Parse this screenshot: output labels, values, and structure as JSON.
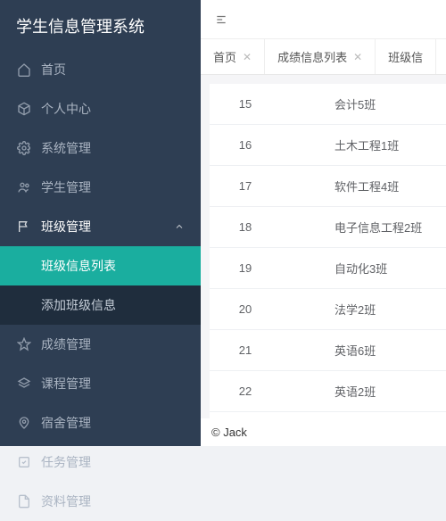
{
  "system_title": "学生信息管理系统",
  "sidebar": {
    "items": [
      {
        "label": "首页",
        "icon": "home"
      },
      {
        "label": "个人中心",
        "icon": "cube"
      },
      {
        "label": "系统管理",
        "icon": "gear"
      },
      {
        "label": "学生管理",
        "icon": "users"
      },
      {
        "label": "班级管理",
        "icon": "flag",
        "expanded": true
      },
      {
        "label": "成绩管理",
        "icon": "star"
      },
      {
        "label": "课程管理",
        "icon": "layers"
      },
      {
        "label": "宿舍管理",
        "icon": "location"
      },
      {
        "label": "任务管理",
        "icon": "check"
      },
      {
        "label": "资料管理",
        "icon": "doc"
      }
    ],
    "submenu": [
      {
        "label": "班级信息列表",
        "selected": true
      },
      {
        "label": "添加班级信息",
        "selected": false
      }
    ]
  },
  "tabs": [
    {
      "label": "首页",
      "closable": true
    },
    {
      "label": "成绩信息列表",
      "closable": true
    },
    {
      "label": "班级信",
      "closable": false
    }
  ],
  "table": {
    "rows": [
      {
        "idx": 15,
        "name": "会计5班"
      },
      {
        "idx": 16,
        "name": "土木工程1班"
      },
      {
        "idx": 17,
        "name": "软件工程4班"
      },
      {
        "idx": 18,
        "name": "电子信息工程2班"
      },
      {
        "idx": 19,
        "name": "自动化3班"
      },
      {
        "idx": 20,
        "name": "法学2班"
      },
      {
        "idx": 21,
        "name": "英语6班"
      },
      {
        "idx": 22,
        "name": "英语2班"
      }
    ]
  },
  "footer": "© Jack"
}
